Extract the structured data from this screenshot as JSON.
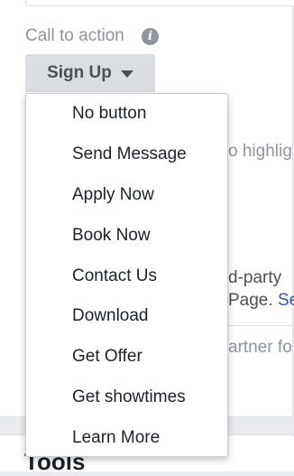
{
  "cta": {
    "label": "Call to action",
    "info_icon": "i",
    "selected": "Sign Up"
  },
  "menu": {
    "items": [
      {
        "label": "No button"
      },
      {
        "label": "Send Message"
      },
      {
        "label": "Apply Now"
      },
      {
        "label": "Book Now"
      },
      {
        "label": "Contact Us"
      },
      {
        "label": "Download"
      },
      {
        "label": "Get Offer"
      },
      {
        "label": "Get showtimes"
      },
      {
        "label": "Learn More"
      }
    ]
  },
  "background": {
    "line1": "o highlig",
    "line2": "d-party",
    "line3_a": "Page. ",
    "line3_link": "Se",
    "line4": "artner fo",
    "section_title": "Tools"
  },
  "colors": {
    "button_bg": "#dadde1",
    "link": "#365899",
    "muted": "#90949c"
  }
}
